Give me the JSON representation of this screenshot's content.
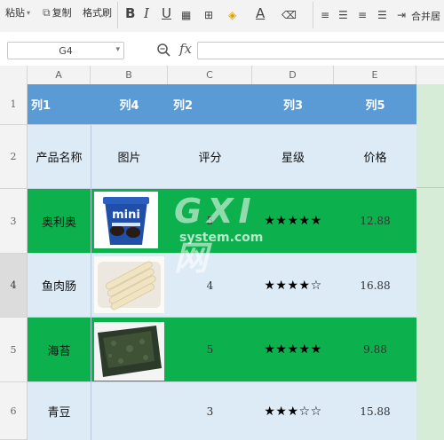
{
  "toolbar": {
    "paste_label": "粘贴",
    "copy_label": "复制",
    "format_painter_label": "格式刷",
    "merge_label": "合并居"
  },
  "formula_bar": {
    "name_box": "G4",
    "fx_label": "fx",
    "formula": ""
  },
  "columns": [
    "A",
    "B",
    "C",
    "D",
    "E"
  ],
  "rows": [
    {
      "num": "1",
      "cells": [
        "列1",
        "列4",
        "列2",
        "列3",
        "列5"
      ]
    },
    {
      "num": "2",
      "cells": [
        "产品名称",
        "图片",
        "评分",
        "星级",
        "价格"
      ]
    },
    {
      "num": "3",
      "cells": [
        "奥利奥",
        "",
        "5",
        "★★★★★",
        "12.88"
      ],
      "image": "oreo-mini-cup"
    },
    {
      "num": "4",
      "cells": [
        "鱼肉肠",
        "",
        "4",
        "★★★★☆",
        "16.88"
      ],
      "image": "fish-sausages"
    },
    {
      "num": "5",
      "cells": [
        "海苔",
        "",
        "5",
        "★★★★★",
        "9.88"
      ],
      "image": "seaweed-snack"
    },
    {
      "num": "6",
      "cells": [
        "青豆",
        "",
        "3",
        "★★★☆☆",
        "15.88"
      ]
    }
  ],
  "colors": {
    "header_blue": "#5b9bd5",
    "light_blue": "#ddebf7",
    "green": "#0cb04c",
    "selection_green": "#d6ecd6"
  },
  "watermark": {
    "brand": "GXI网",
    "domain": "system.com"
  }
}
